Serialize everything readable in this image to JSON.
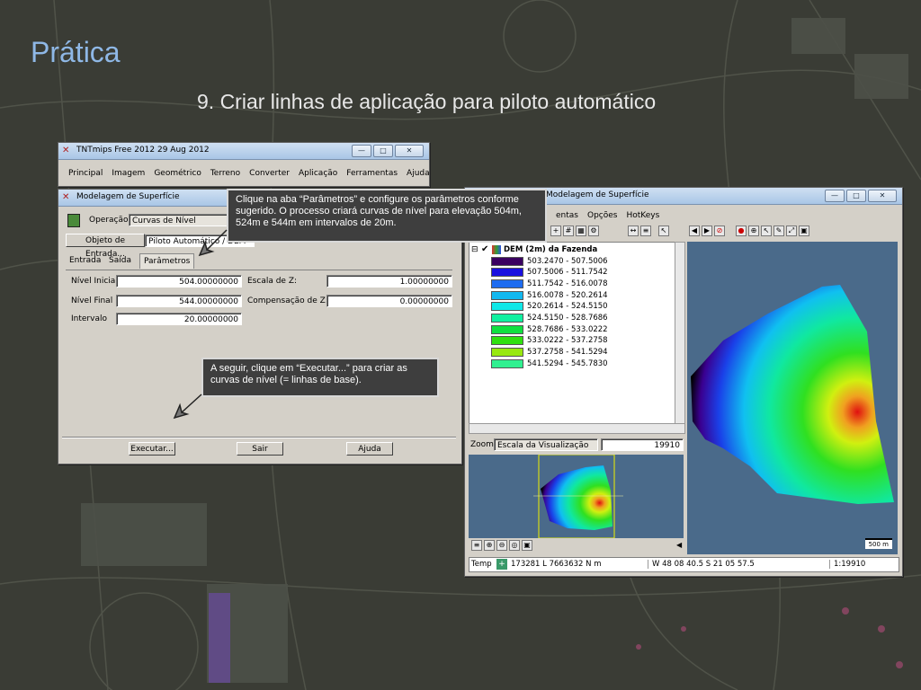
{
  "slide": {
    "title": "Prática",
    "subtitle": "9. Criar linhas de aplicação para piloto automático"
  },
  "tnt_window": {
    "title": "TNTmips Free 2012   29 Aug 2012",
    "menu": [
      "Principal",
      "Imagem",
      "Geométrico",
      "Terreno",
      "Converter",
      "Aplicação",
      "Ferramentas",
      "Ajuda"
    ]
  },
  "surface_window": {
    "title": "Modelagem de Superfície",
    "operation_label": "Operação",
    "operation_value": "Curvas de Nível",
    "input_object_button": "Objeto de Entrada...",
    "input_object_value": "Piloto Automático / DEM",
    "tabs": [
      "Entrada",
      "Saída",
      "Parâmetros"
    ],
    "params": {
      "initial_label": "Nível Inicial",
      "initial_value": "504.00000000",
      "final_label": "Nível Final",
      "final_value": "544.00000000",
      "interval_label": "Intervalo",
      "interval_value": "20.00000000",
      "zscale_label": "Escala de Z:",
      "zscale_value": "1.00000000",
      "zoffset_label": "Compensação de Z:",
      "zoffset_value": "0.00000000"
    },
    "buttons": {
      "run": "Executar...",
      "exit": "Sair",
      "help": "Ajuda"
    }
  },
  "callouts": {
    "params_tip": "Clique na aba “Parâmetros” e configure os parâmetros conforme sugerido. O processo criará curvas de nível para elevação 504m, 524m e 544m em intervalos de 20m.",
    "run_tip": "A seguir, clique em “Executar...” para criar as curvas de nível (= linhas de base)."
  },
  "viewer_window": {
    "title": "Modelagem de Superfície",
    "menu": [
      "entas",
      "Opções",
      "HotKeys"
    ],
    "layer_name": "DEM (2m) da Fazenda",
    "legend": [
      {
        "range": "503.2470 - 507.5006",
        "color": "#3a0060"
      },
      {
        "range": "507.5006 - 511.7542",
        "color": "#1a10e0"
      },
      {
        "range": "511.7542 - 516.0078",
        "color": "#1e6cf0"
      },
      {
        "range": "516.0078 - 520.2614",
        "color": "#12b8f0"
      },
      {
        "range": "520.2614 - 524.5150",
        "color": "#10e8e8"
      },
      {
        "range": "524.5150 - 528.7686",
        "color": "#10f0a0"
      },
      {
        "range": "528.7686 - 533.0222",
        "color": "#10e040"
      },
      {
        "range": "533.0222 - 537.2758",
        "color": "#30e010"
      },
      {
        "range": "537.2758 - 541.5294",
        "color": "#98e810"
      },
      {
        "range": "541.5294 - 545.7830",
        "color": "#30f090"
      }
    ],
    "zoom_label": "Zoom",
    "zoom_mode": "Escala da Visualização",
    "zoom_value": "19910",
    "scalebar": "500 m",
    "status": {
      "label": "Temp",
      "coords": "173281 L  7663632 N m",
      "geo": "W 48 08 40.5  S 21 05 57.5",
      "scale": "1:19910"
    }
  },
  "colors": {
    "title": "#8fb8e6",
    "callout_bg": "#3e3e3e"
  }
}
